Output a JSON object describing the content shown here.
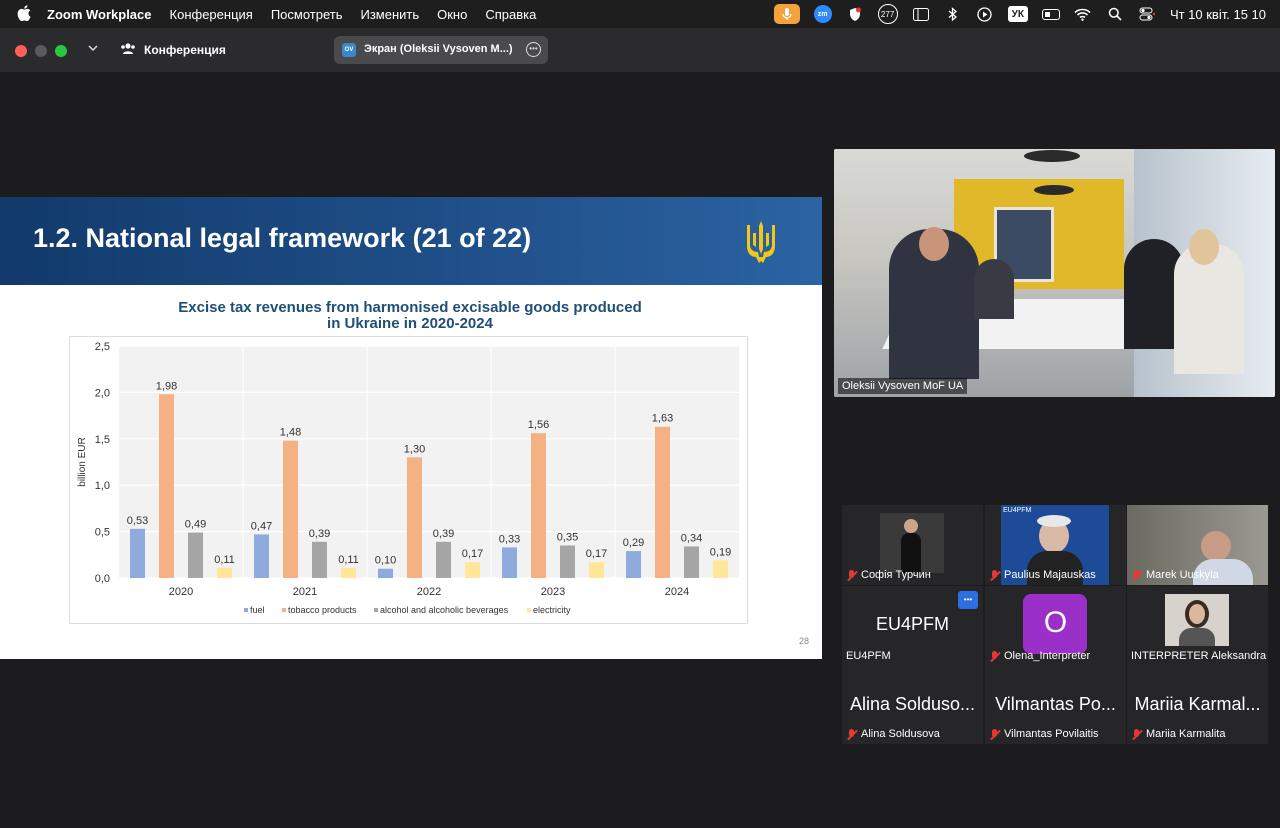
{
  "menubar": {
    "app_name": "Zoom Workplace",
    "menus": [
      "Конференция",
      "Посмотреть",
      "Изменить",
      "Окно",
      "Справка"
    ],
    "badge_count": "277",
    "input_language": "УК",
    "datetime": "Чт 10 квіт.  15 10"
  },
  "window": {
    "title": "Конференция",
    "share_initials": "OV",
    "share_label": "Экран (Oleksii Vysoven M...)"
  },
  "slide": {
    "title": "1.2. National legal framework (21 of 22)",
    "page_number": "28"
  },
  "chart_data": {
    "type": "bar",
    "title": "Excise tax revenues from harmonised excisable goods produced in Ukraine in 2020-2024",
    "title_lines": [
      "Excise tax revenues from harmonised excisable goods produced",
      "in Ukraine in 2020-2024"
    ],
    "ylabel": "billion EUR",
    "xlabel": "",
    "ylim": [
      0,
      2.5
    ],
    "yticks": [
      "0,0",
      "0,5",
      "1,0",
      "1,5",
      "2,0",
      "2,5"
    ],
    "categories": [
      "2020",
      "2021",
      "2022",
      "2023",
      "2024"
    ],
    "series": [
      {
        "name": "fuel",
        "color": "#8faadc",
        "values": [
          0.53,
          0.47,
          0.1,
          0.33,
          0.29
        ],
        "labels": [
          "0,53",
          "0,47",
          "0,10",
          "0,33",
          "0,29"
        ]
      },
      {
        "name": "tobacco products",
        "color": "#f4b183",
        "values": [
          1.98,
          1.48,
          1.3,
          1.56,
          1.63
        ],
        "labels": [
          "1,98",
          "1,48",
          "1,30",
          "1,56",
          "1,63"
        ]
      },
      {
        "name": "alcohol and alcoholic beverages",
        "color": "#a5a5a5",
        "values": [
          0.49,
          0.39,
          0.39,
          0.35,
          0.34
        ],
        "labels": [
          "0,49",
          "0,39",
          "0,39",
          "0,35",
          "0,34"
        ]
      },
      {
        "name": "electricity",
        "color": "#ffe699",
        "values": [
          0.11,
          0.11,
          0.17,
          0.17,
          0.19
        ],
        "labels": [
          "0,11",
          "0,11",
          "0,17",
          "0,17",
          "0,19"
        ]
      }
    ],
    "grid": true,
    "legend_position": "bottom"
  },
  "main_video": {
    "name": "Oleksii Vysoven MoF UA"
  },
  "participants": [
    {
      "name": "Софія Турчин",
      "big": ""
    },
    {
      "name": "Paulius Majauskas",
      "big": ""
    },
    {
      "name": "Marek Uuskyla",
      "big": ""
    },
    {
      "name": "EU4PFM",
      "big": "EU4PFM"
    },
    {
      "name": "Olena_Interpreter",
      "big": "O"
    },
    {
      "name": "INTERPRETER Aleksandra",
      "big": ""
    },
    {
      "name": "Alina Soldusova",
      "big": "Alina Solduso..."
    },
    {
      "name": "Vilmantas Povilaitis",
      "big": "Vilmantas Po..."
    },
    {
      "name": "Mariia Karmalita",
      "big": "Mariia Karmal..."
    }
  ],
  "eu4pfm_logo": "EU4PFM",
  "more_button": "•••"
}
